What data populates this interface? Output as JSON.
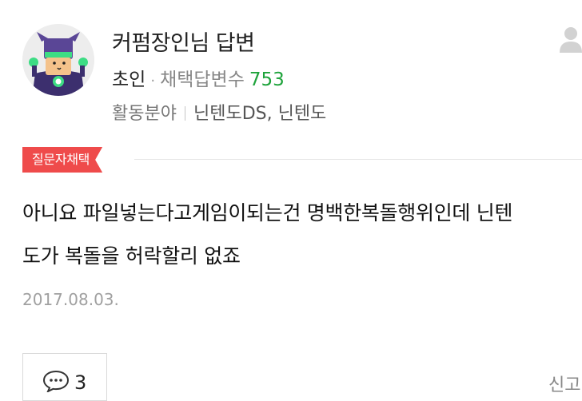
{
  "answerer": {
    "name": "커펌장인님 답변",
    "rank": "초인",
    "adopted_label": "채택답변수",
    "adopted_count": "753",
    "field_label": "활동분야",
    "field_value": "닌텐도DS, 닌텐도"
  },
  "badge": {
    "label": "질문자채택",
    "color": "#ef4b4b"
  },
  "answer": {
    "line1": "아니요 파일넣는다고게임이되는건 명백한복돌행위인데 닌텐",
    "line2": "도가 복돌을 허락할리 없죠"
  },
  "date": "2017.08.03.",
  "footer": {
    "comment_count": "3",
    "report_label": "신고"
  },
  "icons": {
    "avatar": "character-avatar",
    "profile": "person-icon",
    "comment": "speech-bubble-icon"
  },
  "colors": {
    "accent_green": "#1ea33b",
    "badge_red": "#ef4b4b"
  }
}
